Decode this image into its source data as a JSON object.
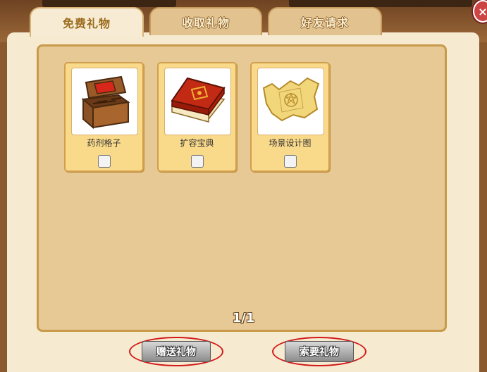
{
  "tabs": [
    {
      "label": "免费礼物",
      "active": true
    },
    {
      "label": "收取礼物",
      "active": false
    },
    {
      "label": "好友请求",
      "active": false
    }
  ],
  "close_label": "×",
  "items": [
    {
      "label": "药剂格子",
      "icon": "treasure-chest-icon",
      "checked": false
    },
    {
      "label": "扩容宝典",
      "icon": "red-book-icon",
      "checked": false
    },
    {
      "label": "场景设计图",
      "icon": "parchment-map-icon",
      "checked": false
    }
  ],
  "pager": "1/1",
  "buttons": {
    "send": "赠送礼物",
    "request": "索要礼物"
  },
  "colors": {
    "accent": "#d11a1a",
    "panel": "#e7c995",
    "card": "#f9d98a"
  }
}
